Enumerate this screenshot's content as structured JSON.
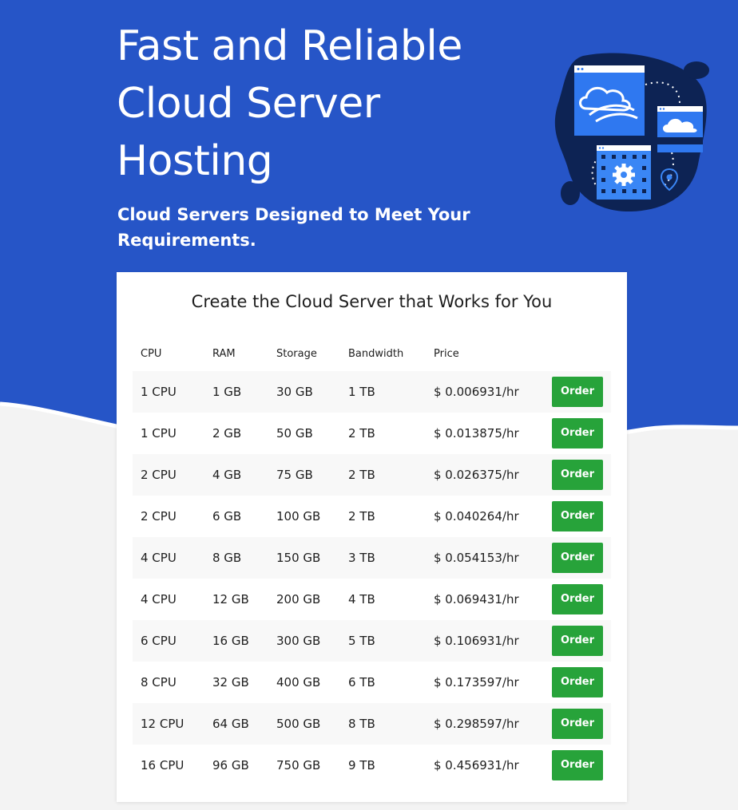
{
  "hero": {
    "title": "Fast and Reliable Cloud Server Hosting",
    "subtitle": "Cloud Servers Designed to Meet Your Requirements."
  },
  "pricing": {
    "title": "Create the Cloud Server that Works for You",
    "columns": {
      "cpu": "CPU",
      "ram": "RAM",
      "storage": "Storage",
      "bandwidth": "Bandwidth",
      "price": "Price"
    },
    "plans": [
      {
        "cpu": "1 CPU",
        "ram": "1 GB",
        "storage": "30 GB",
        "bandwidth": "1 TB",
        "price": "$ 0.006931/hr",
        "action": "Order"
      },
      {
        "cpu": "1 CPU",
        "ram": "2 GB",
        "storage": "50 GB",
        "bandwidth": "2 TB",
        "price": "$ 0.013875/hr",
        "action": "Order"
      },
      {
        "cpu": "2 CPU",
        "ram": "4 GB",
        "storage": "75 GB",
        "bandwidth": "2 TB",
        "price": "$ 0.026375/hr",
        "action": "Order"
      },
      {
        "cpu": "2 CPU",
        "ram": "6 GB",
        "storage": "100 GB",
        "bandwidth": "2 TB",
        "price": "$ 0.040264/hr",
        "action": "Order"
      },
      {
        "cpu": "4 CPU",
        "ram": "8 GB",
        "storage": "150 GB",
        "bandwidth": "3 TB",
        "price": "$ 0.054153/hr",
        "action": "Order"
      },
      {
        "cpu": "4 CPU",
        "ram": "12 GB",
        "storage": "200 GB",
        "bandwidth": "4 TB",
        "price": "$ 0.069431/hr",
        "action": "Order"
      },
      {
        "cpu": "6 CPU",
        "ram": "16 GB",
        "storage": "300 GB",
        "bandwidth": "5 TB",
        "price": "$ 0.106931/hr",
        "action": "Order"
      },
      {
        "cpu": "8 CPU",
        "ram": "32 GB",
        "storage": "400 GB",
        "bandwidth": "6 TB",
        "price": "$ 0.173597/hr",
        "action": "Order"
      },
      {
        "cpu": "12 CPU",
        "ram": "64 GB",
        "storage": "500 GB",
        "bandwidth": "8 TB",
        "price": "$ 0.298597/hr",
        "action": "Order"
      },
      {
        "cpu": "16 CPU",
        "ram": "96 GB",
        "storage": "750 GB",
        "bandwidth": "9 TB",
        "price": "$ 0.456931/hr",
        "action": "Order"
      }
    ]
  },
  "icons": {
    "illustration": "cloud-server-illustration",
    "cloud": "cloud-icon",
    "gear": "gear-icon",
    "location": "location-pin-icon"
  },
  "colors": {
    "hero_background": "#2655c7",
    "page_background": "#f3f3f3",
    "card_background": "#ffffff",
    "order_button": "#27a33a",
    "illustration_blob": "#0d2354"
  }
}
